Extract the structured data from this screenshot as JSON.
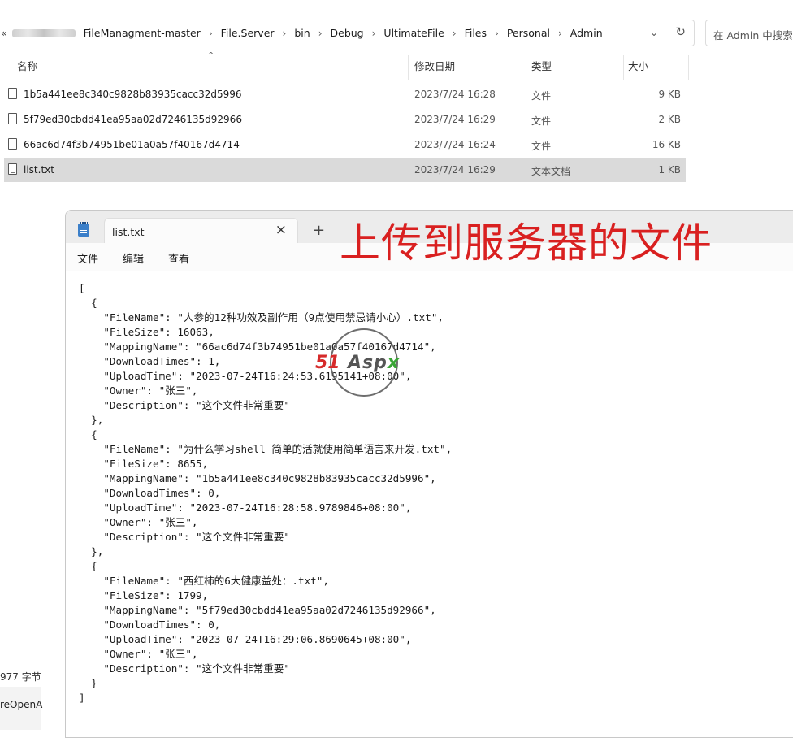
{
  "explorer": {
    "breadcrumb_lead": "«",
    "breadcrumbs": [
      "FileManagment-master",
      "File.Server",
      "bin",
      "Debug",
      "UltimateFile",
      "Files",
      "Personal",
      "Admin"
    ],
    "search_placeholder": "在 Admin 中搜索",
    "columns": {
      "name": "名称",
      "date": "修改日期",
      "type": "类型",
      "size": "大小"
    },
    "files": [
      {
        "name": "1b5a441ee8c340c9828b83935cacc32d5996",
        "date": "2023/7/24 16:28",
        "type": "文件",
        "size": "9 KB"
      },
      {
        "name": "5f79ed30cbdd41ea95aa02d7246135d92966",
        "date": "2023/7/24 16:29",
        "type": "文件",
        "size": "2 KB"
      },
      {
        "name": "66ac6d74f3b74951be01a0a57f40167d4714",
        "date": "2023/7/24 16:24",
        "type": "文件",
        "size": "16 KB"
      },
      {
        "name": "list.txt",
        "date": "2023/7/24 16:29",
        "type": "文本文档",
        "size": "1 KB"
      }
    ],
    "status_text": "977 字节",
    "nav_remnant": "reOpenA"
  },
  "notepad": {
    "tab_title": "list.txt",
    "menu": {
      "file": "文件",
      "edit": "编辑",
      "view": "查看"
    },
    "content": "[\n  {\n    \"FileName\": \"人参的12种功效及副作用（9点使用禁忌请小心）.txt\",\n    \"FileSize\": 16063,\n    \"MappingName\": \"66ac6d74f3b74951be01a0a57f40167d4714\",\n    \"DownloadTimes\": 1,\n    \"UploadTime\": \"2023-07-24T16:24:53.6195141+08:00\",\n    \"Owner\": \"张三\",\n    \"Description\": \"这个文件非常重要\"\n  },\n  {\n    \"FileName\": \"为什么学习shell 简单的活就使用简单语言来开发.txt\",\n    \"FileSize\": 8655,\n    \"MappingName\": \"1b5a441ee8c340c9828b83935cacc32d5996\",\n    \"DownloadTimes\": 0,\n    \"UploadTime\": \"2023-07-24T16:28:58.9789846+08:00\",\n    \"Owner\": \"张三\",\n    \"Description\": \"这个文件非常重要\"\n  },\n  {\n    \"FileName\": \"西红柿的6大健康益处：.txt\",\n    \"FileSize\": 1799,\n    \"MappingName\": \"5f79ed30cbdd41ea95aa02d7246135d92966\",\n    \"DownloadTimes\": 0,\n    \"UploadTime\": \"2023-07-24T16:29:06.8690645+08:00\",\n    \"Owner\": \"张三\",\n    \"Description\": \"这个文件非常重要\"\n  }\n]"
  },
  "annotation": "上传到服务器的文件",
  "watermark": {
    "left": "51",
    "right": "Asp",
    "x": "x"
  }
}
